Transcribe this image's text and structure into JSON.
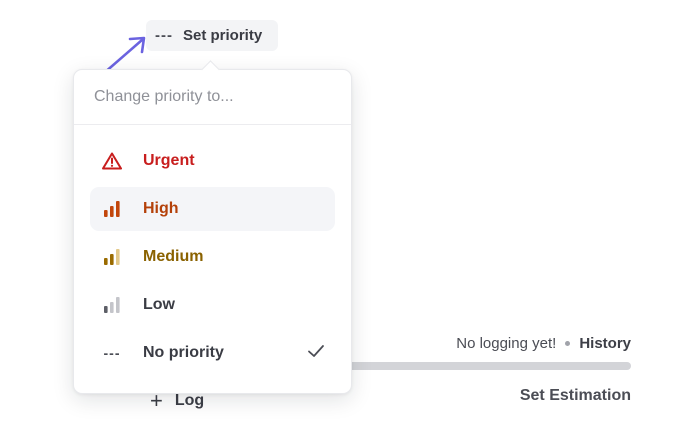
{
  "trigger": {
    "icon": "dashes-icon",
    "label": "Set priority"
  },
  "menu": {
    "search_placeholder": "Change priority to...",
    "items": [
      {
        "label": "Urgent",
        "icon": "warning-triangle-icon",
        "color": "#c81e1e"
      },
      {
        "label": "High",
        "icon": "signal-bars-high-icon",
        "color": "#b4410a",
        "highlighted": true
      },
      {
        "label": "Medium",
        "icon": "signal-bars-medium-icon",
        "color": "#8a6200"
      },
      {
        "label": "Low",
        "icon": "signal-bars-low-icon",
        "color": "#3a3c44"
      },
      {
        "label": "No priority",
        "icon": "dashes-icon",
        "color": "#3a3c44",
        "selected": true
      }
    ]
  },
  "background": {
    "status_text": "No logging yet!",
    "history_link": "History",
    "estimation_label": "Set Estimation",
    "log_label": "Log"
  },
  "colors": {
    "arrow": "#6b63e0",
    "urgent": "#c81e1e",
    "high": "#b4410a",
    "medium": "#8a6200"
  }
}
